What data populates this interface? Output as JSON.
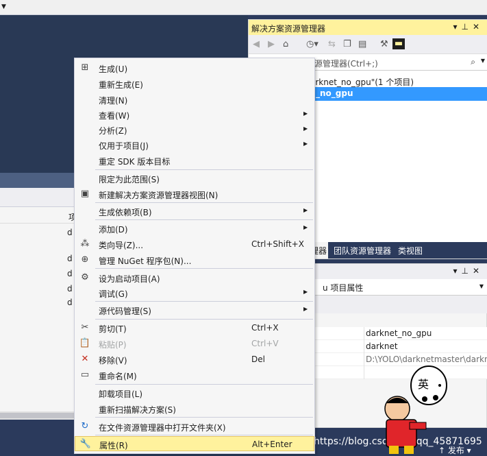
{
  "solution_explorer": {
    "title": "解决方案资源管理器",
    "search_placeholder": "源管理器(Ctrl+;)",
    "solution_label": "arknet_no_gpu\"(1 个项目)",
    "project_label": "_no_gpu",
    "tabs": [
      "理器",
      "团队资源管理器",
      "类视图"
    ]
  },
  "properties": {
    "object_label": "u 项目属性",
    "values": [
      "darknet_no_gpu",
      "darknet",
      "D:\\YOLO\\darknetmaster\\darkn"
    ]
  },
  "left_panel": {
    "column_header": "项",
    "row_prefixes": [
      "d",
      "d",
      "d",
      "d",
      "d"
    ]
  },
  "context_menu": {
    "items": [
      {
        "label": "生成(U)",
        "icon": "build-icon"
      },
      {
        "label": "重新生成(E)"
      },
      {
        "label": "清理(N)"
      },
      {
        "label": "查看(W)",
        "submenu": true
      },
      {
        "label": "分析(Z)",
        "submenu": true
      },
      {
        "label": "仅用于项目(J)",
        "submenu": true
      },
      {
        "label": "重定 SDK 版本目标"
      },
      {
        "label": "限定为此范围(S)"
      },
      {
        "label": "新建解决方案资源管理器视图(N)",
        "icon": "new-view-icon"
      },
      {
        "label": "生成依赖项(B)",
        "submenu": true
      },
      {
        "label": "添加(D)",
        "submenu": true
      },
      {
        "label": "类向导(Z)...",
        "shortcut": "Ctrl+Shift+X",
        "icon": "class-wizard-icon"
      },
      {
        "label": "管理 NuGet 程序包(N)...",
        "icon": "nuget-icon"
      },
      {
        "label": "设为启动项目(A)",
        "icon": "gear-icon"
      },
      {
        "label": "调试(G)",
        "submenu": true
      },
      {
        "label": "源代码管理(S)",
        "submenu": true
      },
      {
        "label": "剪切(T)",
        "shortcut": "Ctrl+X",
        "icon": "scissors-icon"
      },
      {
        "label": "粘贴(P)",
        "shortcut": "Ctrl+V",
        "disabled": true,
        "icon": "paste-icon"
      },
      {
        "label": "移除(V)",
        "shortcut": "Del",
        "icon": "remove-icon"
      },
      {
        "label": "重命名(M)",
        "icon": "rename-icon"
      },
      {
        "label": "卸载项目(L)"
      },
      {
        "label": "重新扫描解决方案(S)"
      },
      {
        "label": "在文件资源管理器中打开文件夹(X)",
        "icon": "refresh-arrow-icon"
      },
      {
        "label": "属性(R)",
        "shortcut": "Alt+Enter",
        "highlighted": true,
        "icon": "wrench-icon"
      }
    ]
  },
  "sticker": {
    "text": "英"
  },
  "watermark": "https://blog.csdn.net/qq_45871695",
  "status": {
    "publish": "↑ 发布 ▾"
  },
  "colors": {
    "highlight": "#fff29d",
    "selection": "#3399ff",
    "navy": "#2b3a5c",
    "remove": "#c42b1c"
  }
}
